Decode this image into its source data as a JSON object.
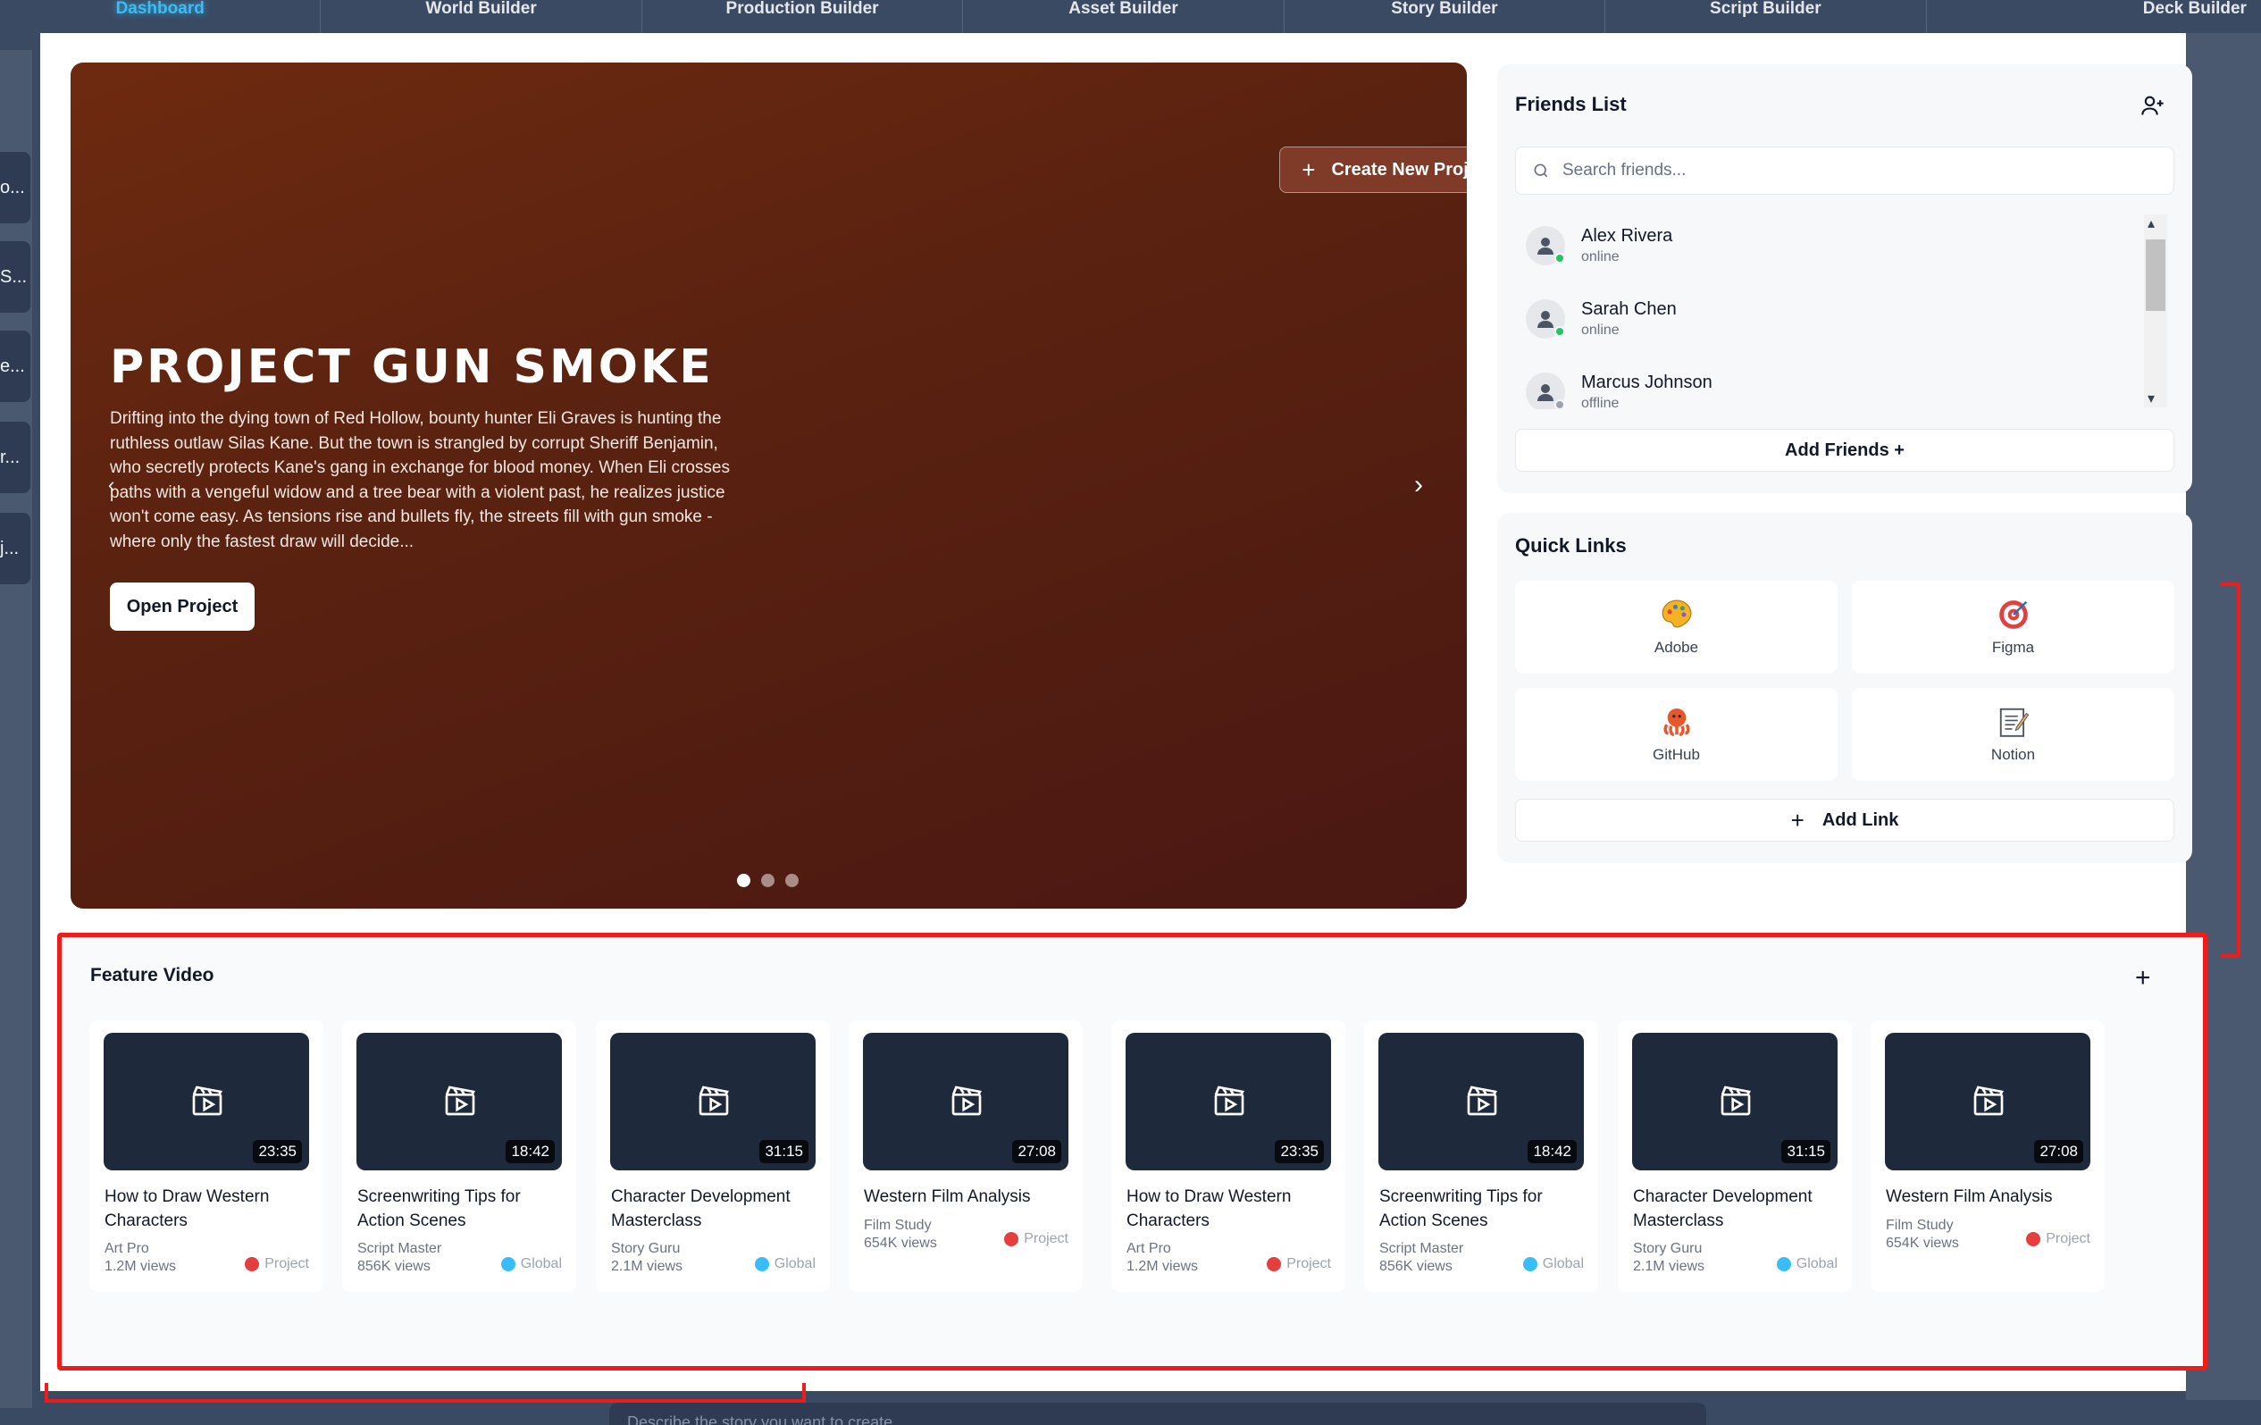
{
  "nav": {
    "tabs": [
      {
        "label": "Dashboard",
        "active": true
      },
      {
        "label": "World Builder"
      },
      {
        "label": "Production Builder"
      },
      {
        "label": "Asset Builder"
      },
      {
        "label": "Story Builder"
      },
      {
        "label": "Script Builder"
      },
      {
        "label": "Deck Builder"
      }
    ]
  },
  "sidebar": {
    "items": [
      "o...",
      "S...",
      "e...",
      "r...",
      "j..."
    ]
  },
  "hero": {
    "create_label": "Create New Project",
    "title": "PROJECT GUN SMOKE",
    "description": "Drifting into the dying town of Red Hollow, bounty hunter Eli Graves is hunting the ruthless outlaw Silas Kane. But the town is strangled by corrupt Sheriff Benjamin, who secretly protects Kane's gang in exchange for blood money. When Eli crosses paths with a vengeful widow and a tree bear with a violent past, he realizes justice won't come easy. As tensions rise and bullets fly, the streets fill with gun smoke - where only the fastest draw will decide...",
    "open_label": "Open Project",
    "slide_count": 3,
    "active_slide": 1,
    "colors": {
      "gradient_start": "#6e2a10",
      "gradient_end": "#4a1712"
    }
  },
  "friends": {
    "title": "Friends List",
    "search_placeholder": "Search friends...",
    "list": [
      {
        "name": "Alex Rivera",
        "status": "online",
        "status_color": "#22c55e"
      },
      {
        "name": "Sarah Chen",
        "status": "online",
        "status_color": "#22c55e"
      },
      {
        "name": "Marcus Johnson",
        "status": "offline",
        "status_color": "#9ca3af"
      }
    ],
    "add_label": "Add Friends +"
  },
  "quick_links": {
    "title": "Quick Links",
    "links": [
      {
        "label": "Adobe",
        "icon": "palette-icon"
      },
      {
        "label": "Figma",
        "icon": "target-icon"
      },
      {
        "label": "GitHub",
        "icon": "octopus-icon"
      },
      {
        "label": "Notion",
        "icon": "memo-icon"
      }
    ],
    "add_label": "Add Link"
  },
  "feature": {
    "title": "Feature Video",
    "videos": [
      {
        "title": "How to Draw Western Characters",
        "author": "Art Pro",
        "views": "1.2M views",
        "duration": "23:35",
        "tag": "Project"
      },
      {
        "title": "Screenwriting Tips for Action Scenes",
        "author": "Script Master",
        "views": "856K views",
        "duration": "18:42",
        "tag": "Global"
      },
      {
        "title": "Character Development Masterclass",
        "author": "Story Guru",
        "views": "2.1M views",
        "duration": "31:15",
        "tag": "Global"
      },
      {
        "title": "Western Film Analysis",
        "author": "Film Study",
        "views": "654K views",
        "duration": "27:08",
        "tag": "Project"
      },
      {
        "title": "How to Draw Western Characters",
        "author": "Art Pro",
        "views": "1.2M views",
        "duration": "23:35",
        "tag": "Project"
      },
      {
        "title": "Screenwriting Tips for Action Scenes",
        "author": "Script Master",
        "views": "856K views",
        "duration": "18:42",
        "tag": "Global"
      },
      {
        "title": "Character Development Masterclass",
        "author": "Story Guru",
        "views": "2.1M views",
        "duration": "31:15",
        "tag": "Global"
      },
      {
        "title": "Western Film Analysis",
        "author": "Film Study",
        "views": "654K views",
        "duration": "27:08",
        "tag": "Project"
      }
    ]
  },
  "bottom_input": {
    "placeholder": "Describe the story you want to create..."
  },
  "colors": {
    "accent": "#38bdf8",
    "highlight_outline": "#ef1c1c",
    "nav_bg": "#3a4a62"
  }
}
